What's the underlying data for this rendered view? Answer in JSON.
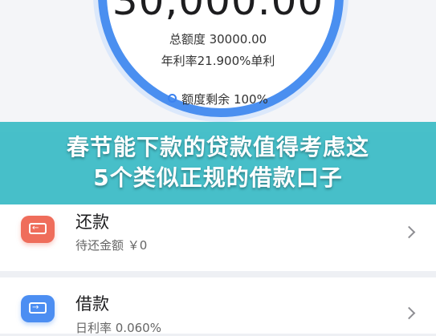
{
  "credit": {
    "amount": "30,000.00",
    "total_line": "总额度 30000.00",
    "rate_line": "年利率21.900%单利",
    "remaining": "额度剩余 100%"
  },
  "banner": {
    "title_line1": "春节能下款的贷款值得考虑这",
    "title_line2": "5个类似正规的借款口子"
  },
  "items": [
    {
      "title": "还款",
      "subtitle": "待还金额 ￥0",
      "icon": "repay-card-icon"
    },
    {
      "title": "借款",
      "subtitle": "日利率 0.060%",
      "icon": "borrow-card-icon"
    }
  ],
  "colors": {
    "ring": "#4a8ff0",
    "banner": "#38bbc4",
    "repay_icon": "#ef6d5b",
    "borrow_icon": "#4c8ef2"
  }
}
